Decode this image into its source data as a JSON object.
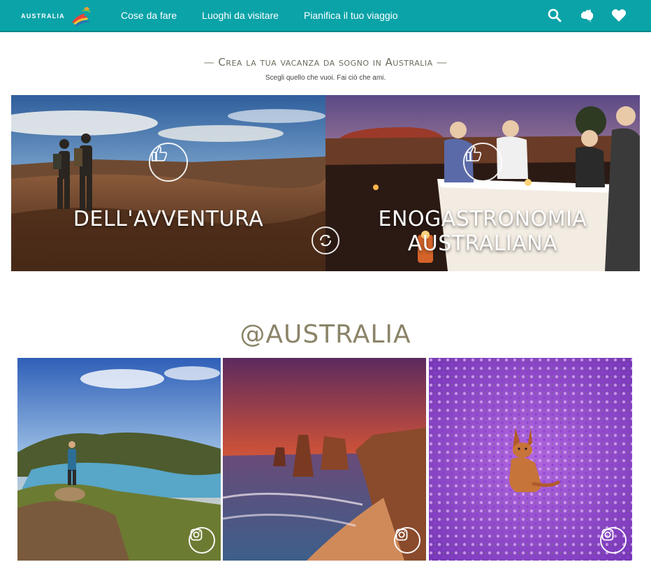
{
  "header": {
    "logo_text": "AUSTRALIA",
    "nav": [
      {
        "label": "Cose da fare"
      },
      {
        "label": "Luoghi da visitare"
      },
      {
        "label": "Pianifica il tuo viaggio"
      }
    ],
    "icons": [
      "search-icon",
      "australia-map-icon",
      "heart-icon"
    ]
  },
  "intro": {
    "tagline": "Crea la tua vacanza da sogno in Australia",
    "subtitle": "Scegli quello che vuoi. Fai ciò che ami."
  },
  "hero": {
    "left_title": "DELL'AVVENTURA",
    "right_title": "ENOGASTRONOMIA AUSTRALIANA"
  },
  "instagram": {
    "handle": "@AUSTRALIA"
  },
  "colors": {
    "brand_teal": "#0aa3a8",
    "heading_olive": "#8b8468"
  }
}
